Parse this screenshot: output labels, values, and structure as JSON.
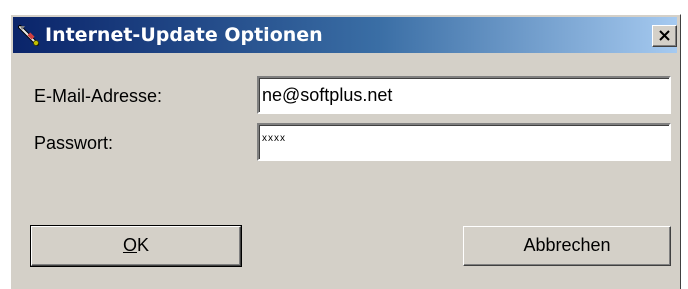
{
  "dialog": {
    "title": "Internet-Update Optionen",
    "icons": {
      "app": "tool-icon",
      "close": "close-icon"
    },
    "colors": {
      "title_start": "#0a246a",
      "title_end": "#a6caf0",
      "face": "#d4d0c8"
    }
  },
  "form": {
    "email_label": "E-Mail-Adresse:",
    "email_value": "ne@softplus.net",
    "password_label": "Passwort:",
    "password_value": "xxxx"
  },
  "buttons": {
    "ok_mnemonic": "O",
    "ok_rest": "K",
    "cancel_label": "Abbrechen"
  }
}
